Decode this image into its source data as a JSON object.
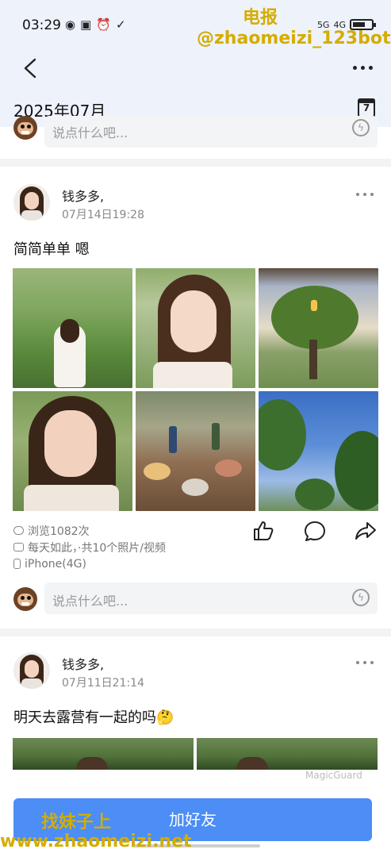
{
  "status": {
    "time": "03:29",
    "net1": "5G",
    "net2": "4G"
  },
  "header": {
    "month": "2025年07月",
    "calendar_day": "7"
  },
  "watermark": {
    "line1": "电报",
    "line2": "@zhaomeizi_123bot",
    "cta_overlay": "找妹子上",
    "bottom": "www.zhaomeizi.net"
  },
  "comment_placeholder": "说点什么吧...",
  "posts": [
    {
      "author": "钱多多,",
      "time": "07月14日19:28",
      "text": "简简单单 嗯",
      "views": "浏览1082次",
      "album": "每天如此，·共10个照片/视频",
      "device": "iPhone(4G)"
    },
    {
      "author": "钱多多,",
      "time": "07月11日21:14",
      "text": "明天去露营有一起的吗🤔"
    }
  ],
  "magic_guard": "MagicGuard",
  "cta": {
    "label": "加好友"
  }
}
